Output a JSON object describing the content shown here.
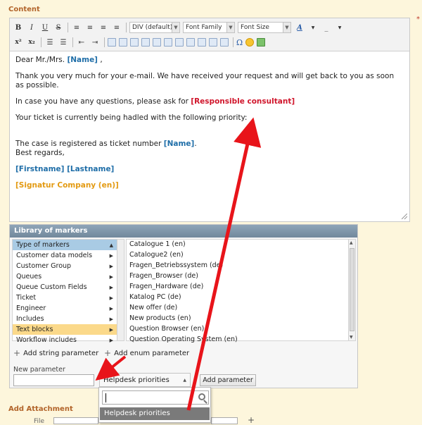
{
  "section": {
    "content_title": "Content",
    "required_mark": "*",
    "attachment_title": "Add Attachment"
  },
  "toolbar": {
    "bold": "B",
    "italic": "I",
    "underline": "U",
    "strike": "S",
    "format_combo": "DIV (default)",
    "font_family_combo": "Font Family",
    "font_size_combo": "Font Size",
    "superscript": "x²",
    "subscript": "x₂",
    "special_char": "Ω"
  },
  "editor": {
    "greeting_prefix": "Dear Mr./Mrs.",
    "greeting_marker": "[Name]",
    "greeting_suffix": ",",
    "para1": "Thank you very much for your e-mail. We have received your request and will get back to you as soon as possible.",
    "para2_prefix": "In case you have any questions, please ask for",
    "para2_marker": "[Responsible consultant]",
    "para3": "Your ticket is currently being hadled with the following priority:",
    "para4_prefix": "The case is registered as ticket number",
    "para4_marker": "[Name]",
    "para4_suffix": ".",
    "regards": "Best regards,",
    "name_marker": "[Firstname] [Lastname]",
    "signature_marker": "[Signatur Company (en)]"
  },
  "library": {
    "title": "Library of markers",
    "categories": [
      {
        "label": "Type of markers"
      },
      {
        "label": "Customer data models"
      },
      {
        "label": "Customer Group"
      },
      {
        "label": "Queues"
      },
      {
        "label": "Queue Custom Fields"
      },
      {
        "label": "Ticket"
      },
      {
        "label": "Engineer"
      },
      {
        "label": "Includes"
      },
      {
        "label": "Text blocks"
      },
      {
        "label": "Workflow includes"
      }
    ],
    "items": [
      {
        "label": "Catalogue 1 (en)"
      },
      {
        "label": "Catalogue2 (en)"
      },
      {
        "label": "Fragen_Betriebssystem (de)"
      },
      {
        "label": "Fragen_Browser (de)"
      },
      {
        "label": "Fragen_Hardware (de)"
      },
      {
        "label": "Katalog PC (de)"
      },
      {
        "label": "New offer (de)"
      },
      {
        "label": "New products (en)"
      },
      {
        "label": "Question Browser (en)"
      },
      {
        "label": "Question Operating System (en)"
      }
    ],
    "add_string_param": "Add string parameter",
    "add_enum_param": "Add enum parameter",
    "new_param_label": "New parameter",
    "new_param_value": "",
    "enum_selected": "Helpdesk priorities",
    "add_param_button": "Add parameter"
  },
  "dropdown": {
    "search_value": "",
    "options": [
      {
        "label": "Helpdesk priorities"
      }
    ]
  },
  "attachment": {
    "file_label": "File"
  },
  "colors": {
    "marker_blue": "#1f6ea8",
    "marker_red": "#d0152b",
    "marker_orange": "#e39a12",
    "annotation_arrow": "#e8141a",
    "section_title": "#b2642a"
  }
}
